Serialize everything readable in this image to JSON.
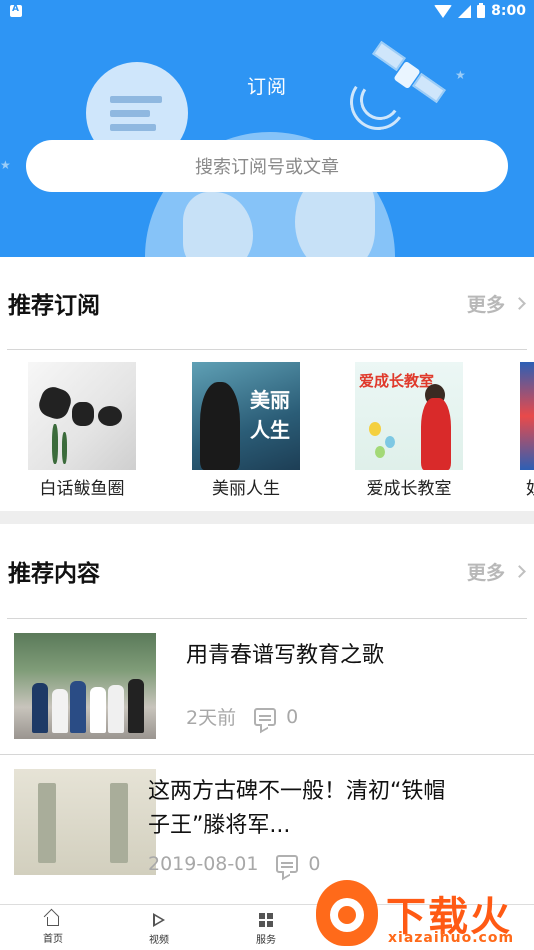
{
  "status_bar": {
    "time": "8:00"
  },
  "header": {
    "title": "订阅",
    "search_placeholder": "搜索订阅号或文章"
  },
  "recommended_subscriptions": {
    "title": "推荐订阅",
    "more_label": "更多",
    "items": [
      {
        "label": "白话鲅鱼圈"
      },
      {
        "label": "美丽人生",
        "cover_text_1": "美丽",
        "cover_text_2": "人生"
      },
      {
        "label": "爱成长教室",
        "cover_text": "爱成长教室"
      },
      {
        "label": "奴"
      }
    ]
  },
  "recommended_content": {
    "title": "推荐内容",
    "more_label": "更多",
    "articles": [
      {
        "title": "用青春谱写教育之歌",
        "time": "2天前",
        "comments": "0"
      },
      {
        "title_line1": "这两方古碑不一般！清初“铁帽",
        "title_line2": "子王”滕将军...",
        "time": "2019-08-01",
        "comments": "0"
      }
    ]
  },
  "bottom_nav": {
    "items": [
      {
        "label": "首页",
        "icon": "home-icon"
      },
      {
        "label": "视频",
        "icon": "play-icon"
      },
      {
        "label": "服务",
        "icon": "grid-icon"
      }
    ]
  },
  "watermark": {
    "text": "下载火",
    "url": "xiazaihuo.com"
  },
  "colors": {
    "primary": "#2e95f4",
    "watermark": "#ff5a14"
  }
}
